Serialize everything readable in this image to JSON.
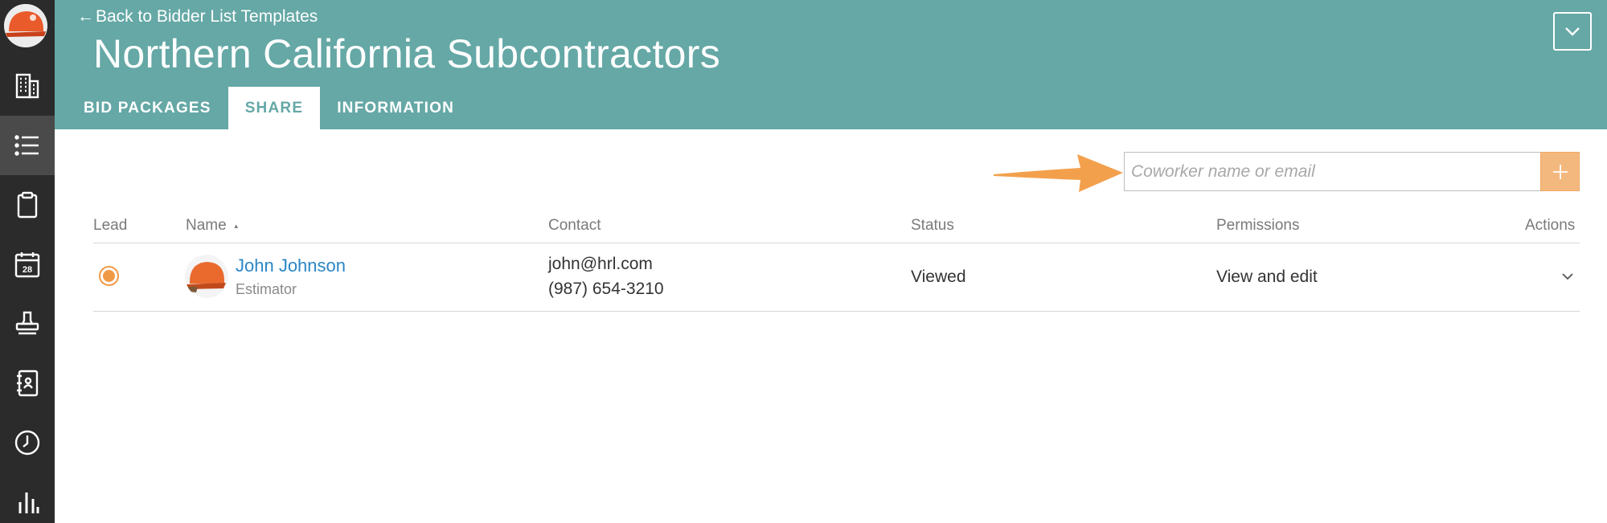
{
  "sidebar": {
    "items": [
      {
        "icon": "building-icon"
      },
      {
        "icon": "list-icon",
        "active": true
      },
      {
        "icon": "clipboard-icon"
      },
      {
        "icon": "calendar-icon",
        "label": "28"
      },
      {
        "icon": "stamp-icon"
      },
      {
        "icon": "address-book-icon"
      },
      {
        "icon": "clock-icon"
      },
      {
        "icon": "bar-chart-icon"
      }
    ]
  },
  "header": {
    "back_link": "Back to Bidder List Templates",
    "back_arrow": "←",
    "title": "Northern California Subcontractors",
    "tabs": [
      {
        "label": "BID PACKAGES",
        "active": false
      },
      {
        "label": "SHARE",
        "active": true
      },
      {
        "label": "INFORMATION",
        "active": false
      }
    ]
  },
  "add_coworker": {
    "placeholder": "Coworker name or email",
    "value": "",
    "add_icon": "plus-icon"
  },
  "table": {
    "columns": [
      "Lead",
      "Name",
      "Contact",
      "Status",
      "Permissions",
      "Actions"
    ],
    "sort_indicator": "▲",
    "rows": [
      {
        "lead_selected": true,
        "name": "John Johnson",
        "role": "Estimator",
        "email": "john@hrl.com",
        "phone": "(987) 654-3210",
        "status": "Viewed",
        "permissions": "View and edit"
      }
    ]
  },
  "colors": {
    "header": "#65a8a6",
    "sidebar": "#2b2b2b",
    "accent_orange": "#f19a46",
    "link_blue": "#2a86c6"
  }
}
